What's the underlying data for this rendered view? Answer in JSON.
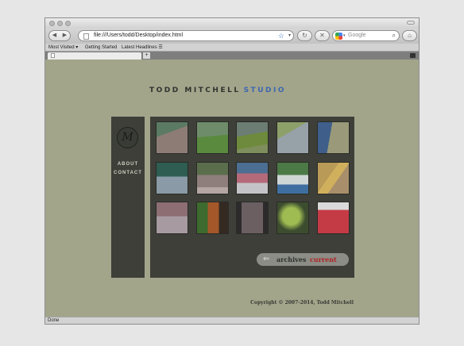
{
  "browser": {
    "url": "file:///Users/todd/Desktop/index.html",
    "search_placeholder": "Google",
    "bookmarks": [
      "Most Visited ▾",
      "Getting Started",
      "Latest Headlines ☰"
    ],
    "status": "Done"
  },
  "site": {
    "title_part1": "TODD MITCHELL",
    "title_part2": "STUDIO",
    "logo_monogram": "M",
    "nav": [
      "ABOUT",
      "CONTACT"
    ],
    "pager": {
      "prev": "archives",
      "active": "current"
    },
    "copyright": "Copyright © 2007-2014, Todd Mitchell"
  },
  "colors": {
    "page_bg": "#a3a58b",
    "panel_bg": "#3d3f38",
    "title_accent": "#3d67b0",
    "pager_active": "#b02224"
  }
}
